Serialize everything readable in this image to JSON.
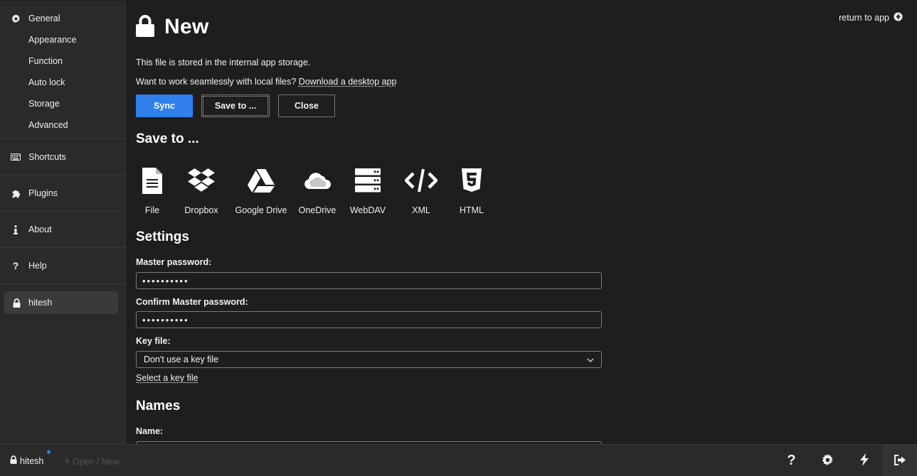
{
  "sidebar": {
    "general": "General",
    "subitems": [
      "Appearance",
      "Function",
      "Auto lock",
      "Storage",
      "Advanced"
    ],
    "shortcuts": "Shortcuts",
    "plugins": "Plugins",
    "about": "About",
    "help": "Help",
    "file": "hitesh"
  },
  "header": {
    "return_link": "return to app",
    "title": "New"
  },
  "info": {
    "storage_text": "This file is stored in the internal app storage.",
    "desktop_prompt": "Want to work seamlessly with local files?",
    "desktop_link": "Download a desktop app"
  },
  "buttons": {
    "sync": "Sync",
    "save_to": "Save to ...",
    "close": "Close"
  },
  "save_to": {
    "heading": "Save to ...",
    "options": [
      {
        "label": "File",
        "icon": "file-icon"
      },
      {
        "label": "Dropbox",
        "icon": "dropbox-icon"
      },
      {
        "label": "Google Drive",
        "icon": "google-drive-icon"
      },
      {
        "label": "OneDrive",
        "icon": "onedrive-icon"
      },
      {
        "label": "WebDAV",
        "icon": "webdav-icon"
      },
      {
        "label": "XML",
        "icon": "code-icon"
      },
      {
        "label": "HTML",
        "icon": "html5-icon"
      }
    ]
  },
  "settings": {
    "heading": "Settings",
    "master_password_label": "Master password:",
    "master_password_value": "••••••••••",
    "confirm_password_label": "Confirm Master password:",
    "confirm_password_value": "••••••••••",
    "key_file_label": "Key file:",
    "key_file_value": "Don't use a key file",
    "select_key_file": "Select a key file"
  },
  "names": {
    "heading": "Names",
    "name_label": "Name:"
  },
  "footer": {
    "user": "hitesh",
    "open_new": "Open / New"
  },
  "colors": {
    "accent": "#2f80ed",
    "background": "#1e1e1e",
    "sidebar": "#2a2a2a"
  }
}
